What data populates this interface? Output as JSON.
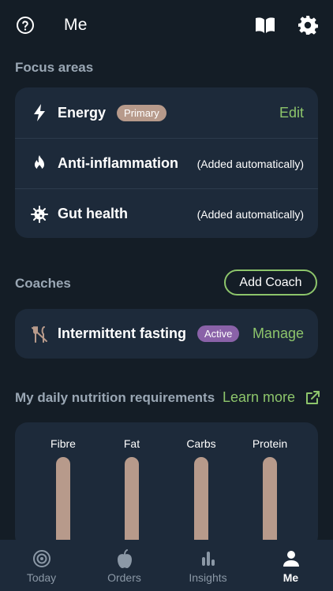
{
  "header": {
    "title": "Me"
  },
  "focus": {
    "label": "Focus areas",
    "items": [
      {
        "title": "Energy",
        "badge": "Primary",
        "action": "Edit",
        "icon": "lightning-icon"
      },
      {
        "title": "Anti-inflammation",
        "note": "(Added automatically)",
        "icon": "flame-icon"
      },
      {
        "title": "Gut health",
        "note": "(Added automatically)",
        "icon": "gut-bacteria-icon"
      }
    ]
  },
  "coaches": {
    "label": "Coaches",
    "add_label": "Add Coach",
    "items": [
      {
        "title": "Intermittent fasting",
        "badge": "Active",
        "action": "Manage",
        "icon": "no-utensils-icon"
      }
    ]
  },
  "nutrition": {
    "label": "My daily nutrition requirements",
    "learn_more": "Learn more",
    "bars": [
      {
        "label": "Fibre"
      },
      {
        "label": "Fat"
      },
      {
        "label": "Carbs"
      },
      {
        "label": "Protein"
      }
    ]
  },
  "tabs": [
    {
      "label": "Today",
      "icon": "target-icon"
    },
    {
      "label": "Orders",
      "icon": "apple-icon"
    },
    {
      "label": "Insights",
      "icon": "bar-chart-icon"
    },
    {
      "label": "Me",
      "icon": "person-icon",
      "active": true
    }
  ],
  "colors": {
    "background": "#141d26",
    "card": "#1d2a3a",
    "accent_green": "#8dc56b",
    "badge_primary": "#b79a8b",
    "badge_active": "#8a62a8",
    "muted": "#9aa7b4"
  }
}
